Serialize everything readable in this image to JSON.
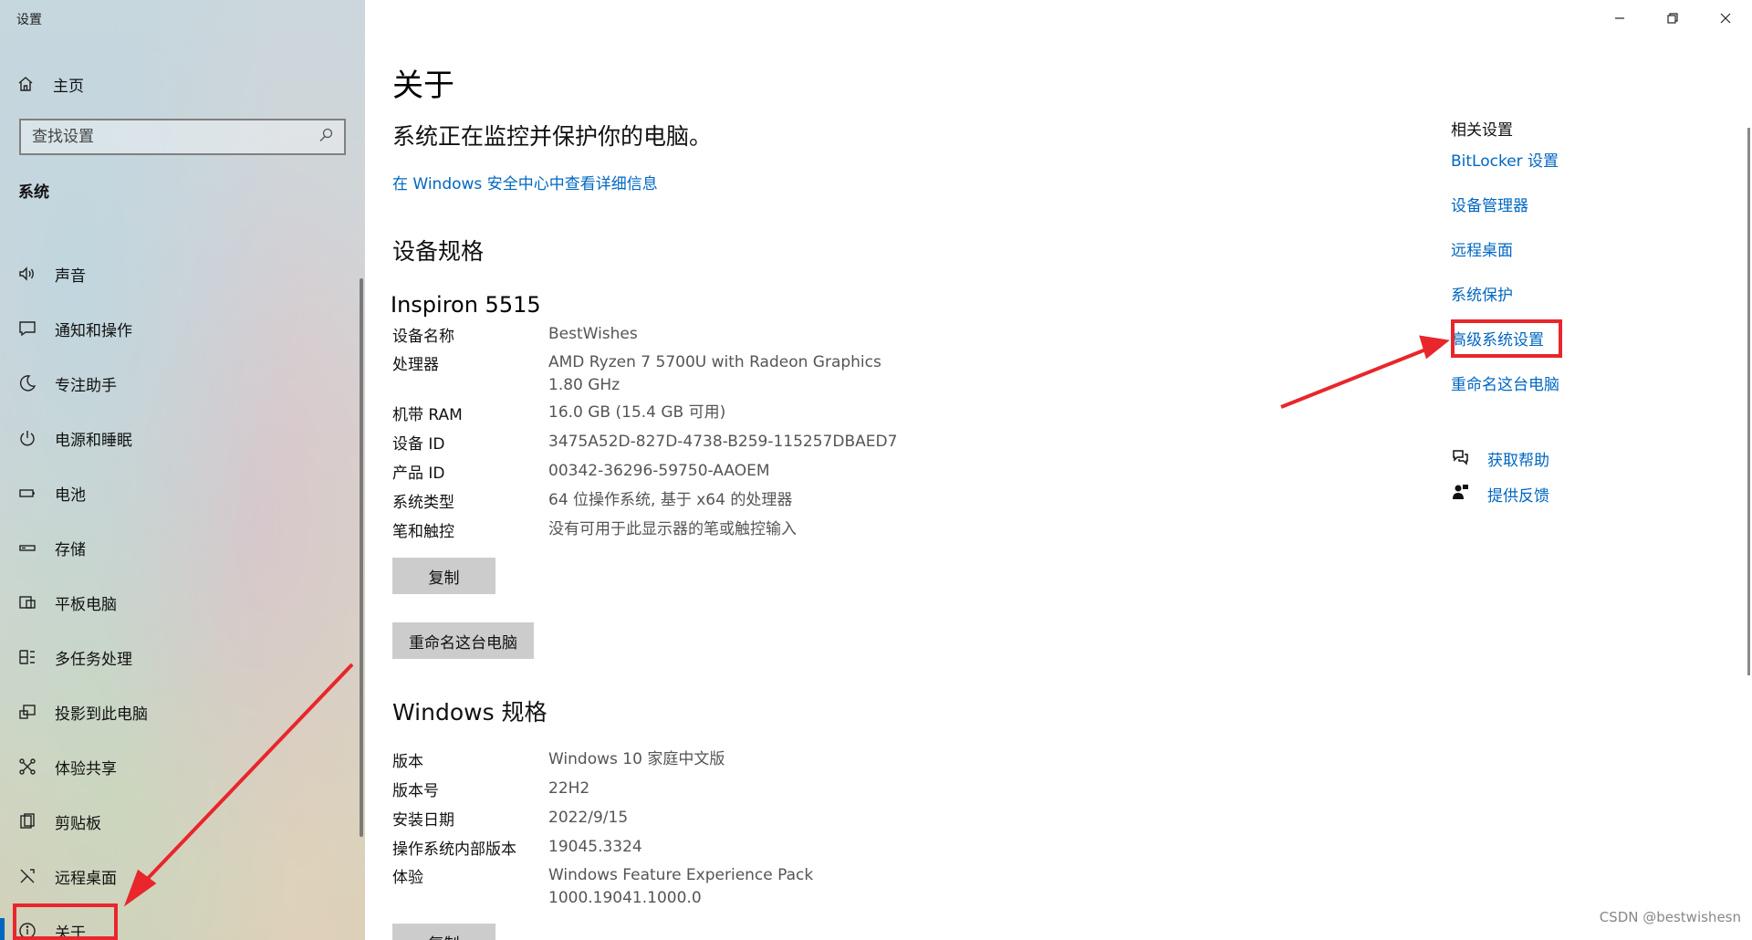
{
  "window": {
    "title": "设置",
    "controls": [
      "minimize-icon",
      "restore-icon",
      "close-icon"
    ]
  },
  "sidebar": {
    "home_label": "主页",
    "search_placeholder": "查找设置",
    "section_title": "系统",
    "items": [
      {
        "label": "声音",
        "icon": "speaker-icon"
      },
      {
        "label": "通知和操作",
        "icon": "notification-icon"
      },
      {
        "label": "专注助手",
        "icon": "moon-icon"
      },
      {
        "label": "电源和睡眠",
        "icon": "power-icon"
      },
      {
        "label": "电池",
        "icon": "battery-icon"
      },
      {
        "label": "存储",
        "icon": "storage-icon"
      },
      {
        "label": "平板电脑",
        "icon": "tablet-icon"
      },
      {
        "label": "多任务处理",
        "icon": "multitask-icon"
      },
      {
        "label": "投影到此电脑",
        "icon": "project-icon"
      },
      {
        "label": "体验共享",
        "icon": "share-icon"
      },
      {
        "label": "剪贴板",
        "icon": "clipboard-icon"
      },
      {
        "label": "远程桌面",
        "icon": "remote-desktop-icon"
      },
      {
        "label": "关于",
        "icon": "info-icon",
        "active": true
      }
    ]
  },
  "main": {
    "title": "关于",
    "protection_status": "系统正在监控并保护你的电脑。",
    "security_link": "在 Windows 安全中心中查看详细信息",
    "device_specs": {
      "heading": "设备规格",
      "model": "Inspiron 5515",
      "rows": [
        {
          "label": "设备名称",
          "value": "BestWishes"
        },
        {
          "label": "处理器",
          "value": "AMD Ryzen 7 5700U with Radeon Graphics",
          "value2": "1.80 GHz"
        },
        {
          "label": "机带 RAM",
          "value": "16.0 GB (15.4 GB 可用)"
        },
        {
          "label": "设备 ID",
          "value": "3475A52D-827D-4738-B259-115257DBAED7"
        },
        {
          "label": "产品 ID",
          "value": "00342-36296-59750-AAOEM"
        },
        {
          "label": "系统类型",
          "value": "64 位操作系统, 基于 x64 的处理器"
        },
        {
          "label": "笔和触控",
          "value": "没有可用于此显示器的笔或触控输入"
        }
      ],
      "copy_button": "复制",
      "rename_button": "重命名这台电脑"
    },
    "windows_specs": {
      "heading": "Windows 规格",
      "rows": [
        {
          "label": "版本",
          "value": "Windows 10 家庭中文版"
        },
        {
          "label": "版本号",
          "value": "22H2"
        },
        {
          "label": "安装日期",
          "value": "2022/9/15"
        },
        {
          "label": "操作系统内部版本",
          "value": "19045.3324"
        },
        {
          "label": "体验",
          "value": "Windows Feature Experience Pack",
          "value2": "1000.19041.1000.0"
        }
      ],
      "copy_button": "复制"
    }
  },
  "related": {
    "heading": "相关设置",
    "links": [
      "BitLocker 设置",
      "设备管理器",
      "远程桌面",
      "系统保护",
      "高级系统设置",
      "重命名这台电脑"
    ],
    "help": [
      {
        "label": "获取帮助",
        "icon": "help-chat-icon"
      },
      {
        "label": "提供反馈",
        "icon": "feedback-icon"
      }
    ]
  },
  "annotation_color": "#e8262b",
  "accent_color": "#0067c0",
  "watermark": "CSDN @bestwishesn"
}
